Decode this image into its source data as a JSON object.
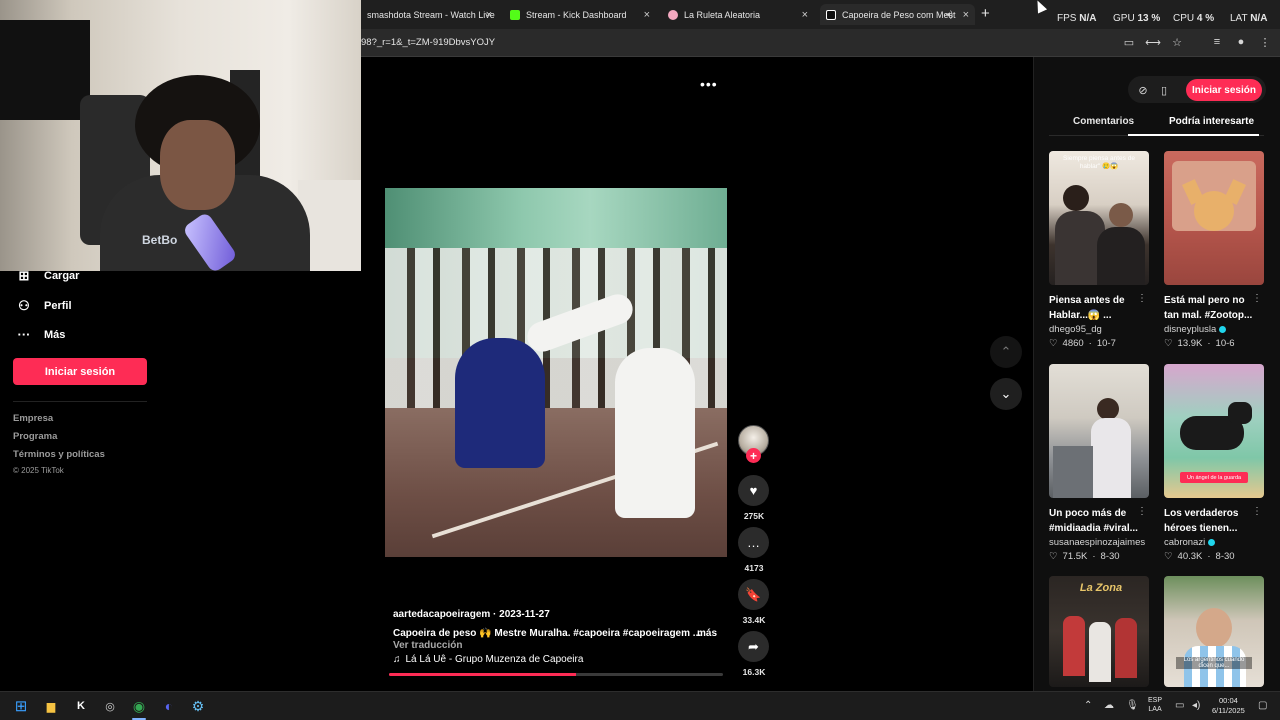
{
  "browser": {
    "tabs": [
      {
        "title": "smashdota Stream - Watch Live",
        "icon_color": "#9b6bff"
      },
      {
        "title": "Stream - Kick Dashboard",
        "icon_color": "#53fc18"
      },
      {
        "title": "La Ruleta Aleatoria",
        "icon_color": "#f4a9c0"
      },
      {
        "title": "Capoeira de Peso com Mest",
        "icon_color": "#ffffff"
      }
    ],
    "new_tab": "+",
    "url": "98?_r=1&_t=ZM-919DbvsYOJY"
  },
  "overlay": {
    "fps_label": "FPS",
    "fps_value": "N/A",
    "gpu_label": "GPU",
    "gpu_value": "13 %",
    "cpu_label": "CPU",
    "cpu_value": "4 %",
    "lat_label": "LAT",
    "lat_value": "N/A"
  },
  "webcam": {
    "shirt_text": "BetBo"
  },
  "sidebar": {
    "items": [
      {
        "label": "Cargar",
        "icon": "upload-icon",
        "glyph": "⊞"
      },
      {
        "label": "Perfil",
        "icon": "profile-icon",
        "glyph": "⚇"
      },
      {
        "label": "Más",
        "icon": "more-icon",
        "glyph": "···"
      }
    ],
    "login_label": "Iniciar sesión",
    "footer_links": [
      "Empresa",
      "Programa",
      "Términos y políticas"
    ],
    "copyright": "© 2025 TikTok"
  },
  "video": {
    "more_glyph": "•••",
    "username": "aartedacapoeiragem",
    "date": "2023-11-27",
    "description": "Capoeira de peso 🙌 Mestre Muralha. #capoeira  #capoeiragem  ...",
    "more_label": "más",
    "translate_label": "Ver traducción",
    "music": "Lá Lá Uê - Grupo Muzenza de Capoeira",
    "progress": 0.56
  },
  "actions": {
    "follow": "+",
    "like": {
      "glyph": "♥",
      "count": "275K"
    },
    "comment": {
      "glyph": "…",
      "count": "4173"
    },
    "save": {
      "glyph": "🔖",
      "count": "33.4K"
    },
    "share": {
      "glyph": "➦",
      "count": "16.3K"
    }
  },
  "nav_arrows": {
    "up": "⌃",
    "down": "⌄"
  },
  "right_panel": {
    "login_label": "Iniciar sesión",
    "tabs": [
      "Comentarios",
      "Podría interesarte"
    ],
    "cards": [
      {
        "title": "Piensa antes de Hablar...😱 ...",
        "author": "dhego95_dg",
        "verified": false,
        "likes": "4860",
        "date": "10-7",
        "thumb_caption": "Siempre piensa antes de hablar\" 🥲😱",
        "thumb_tag": "",
        "colors": [
          "#f2ece4",
          "#3a2f2a"
        ]
      },
      {
        "title": "Está mal pero no tan mal. #Zootop...",
        "author": "disneyplusla",
        "verified": true,
        "likes": "13.9K",
        "date": "10-6",
        "thumb_caption": "",
        "thumb_tag": "",
        "colors": [
          "#b5544d",
          "#d98f6e"
        ]
      },
      {
        "title": "Un poco más de #midiaadia #viral...",
        "author": "susanaespinozajaimes",
        "verified": false,
        "likes": "71.5K",
        "date": "8-30",
        "thumb_caption": "",
        "thumb_tag": "",
        "colors": [
          "#dcd8cf",
          "#5a5e63"
        ]
      },
      {
        "title": "Los verdaderos héroes tienen...",
        "author": "cabronazi",
        "verified": true,
        "likes": "40.3K",
        "date": "8-30",
        "thumb_caption": "",
        "thumb_tag": "Un ángel de la guarda",
        "colors": [
          "#7ecbb3",
          "#d6a2c8"
        ]
      },
      {
        "title": "",
        "author": "",
        "verified": false,
        "likes": "",
        "date": "",
        "thumb_caption": "La Zona",
        "thumb_tag": "",
        "colors": [
          "#2a2522",
          "#c7a64a"
        ]
      },
      {
        "title": "",
        "author": "",
        "verified": false,
        "likes": "",
        "date": "",
        "thumb_caption": "Los argentinos cuando dicen que...",
        "thumb_tag": "",
        "colors": [
          "#6a8a5a",
          "#d9cfc2"
        ]
      }
    ]
  },
  "taskbar": {
    "apps": [
      {
        "name": "windows-start-icon",
        "glyph": "⊞",
        "color": "#3aa0ff"
      },
      {
        "name": "file-explorer-icon",
        "glyph": "▆",
        "color": "#f5c242"
      },
      {
        "name": "kick-app-icon",
        "glyph": "K",
        "color": "#ffffff"
      },
      {
        "name": "obs-icon",
        "glyph": "◎",
        "color": "#cfcfcf"
      },
      {
        "name": "chrome-icon",
        "glyph": "◉",
        "color": "#34a853"
      },
      {
        "name": "discord-icon",
        "glyph": "◐",
        "color": "#5865f2"
      },
      {
        "name": "steam-icon",
        "glyph": "⚙",
        "color": "#66c0f4"
      }
    ],
    "lang_top": "ESP",
    "lang_bottom": "LAA",
    "time": "00:04",
    "date": "6/11/2025"
  }
}
